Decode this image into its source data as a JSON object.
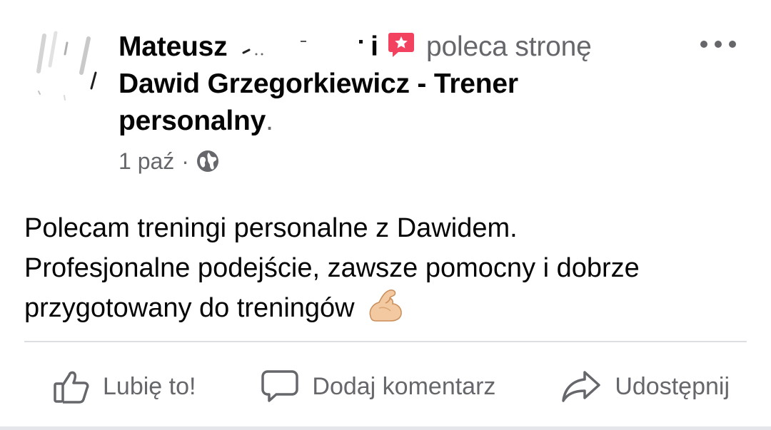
{
  "post": {
    "author_first_name": "Mateusz",
    "author_suffix": "i",
    "action_text": "poleca stronę",
    "page_name": "Dawid Grzegorkiewicz - Trener personalny",
    "page_name_end": ".",
    "date": "1 paź",
    "separator": "·",
    "privacy_icon": "globe-icon",
    "body_line1": "Polecam treningi personalne z Dawidem.",
    "body_line2": "Profesjonalne podejście, zawsze pomocny i dobrze",
    "body_line3": "przygotowany do treningów",
    "body_emoji": "flexed-biceps-emoji"
  },
  "actions": {
    "like_label": "Lubię to!",
    "comment_label": "Dodaj komentarz",
    "share_label": "Udostępnij"
  },
  "colors": {
    "text_primary": "#050505",
    "text_secondary": "#65676b",
    "recommend_icon": "#f3425f",
    "divider": "#dcdee2"
  }
}
